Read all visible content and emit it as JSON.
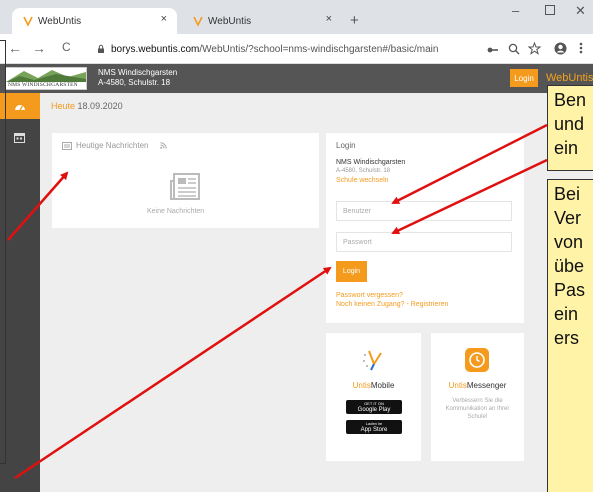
{
  "browser": {
    "tabs": [
      {
        "label": "WebUntis",
        "close": "×"
      },
      {
        "label": "WebUntis",
        "close": "×"
      }
    ],
    "new_tab": "+",
    "window_controls": {
      "minimize": "–",
      "close": "✕"
    },
    "nav": {
      "back": "←",
      "forward": "→",
      "reload": "C"
    },
    "url": {
      "host": "borys.webuntis.com",
      "path": "/WebUntis/?school=nms-windischgarsten#/basic/main"
    },
    "toolbar_icons": [
      "key-icon",
      "zoom-icon",
      "star-icon",
      "profile-icon",
      "menu-icon"
    ]
  },
  "header": {
    "logo_text": "NMS WINDISCHGARSTEN",
    "school_name": "NMS Windischgarsten",
    "school_address": "A-4580, Schulstr. 18",
    "login_button": "Login",
    "brand": "WebUntis"
  },
  "sidebar": {
    "items": [
      {
        "name": "dashboard-icon",
        "glyph": "◕"
      },
      {
        "name": "calendar-icon",
        "glyph": "▦"
      }
    ]
  },
  "main": {
    "today_label": "Heute",
    "today_date": "18.09.2020",
    "news": {
      "title": "Heutige Nachrichten",
      "empty": "Keine Nachrichten"
    },
    "login": {
      "title": "Login",
      "school": "NMS Windischgarsten",
      "address": "A-4580, Schulstr. 18",
      "change_school": "Schule wechseln",
      "username_placeholder": "Benutzer",
      "password_placeholder": "Passwort",
      "button": "Login",
      "forgot": "Passwort vergessen?",
      "register": "Noch keinen Zugang? - Registrieren"
    },
    "mobile": {
      "name_prefix": "Untis",
      "name_suffix": "Mobile",
      "google_small": "GET IT ON",
      "google": "Google Play",
      "apple_small": "Laden im",
      "apple": "App Store"
    },
    "messenger": {
      "name_prefix": "Untis",
      "name_suffix": "Messenger",
      "description": "Verbessern Sie die Kommunikation an Ihrer Schule!"
    }
  },
  "callouts": {
    "top_lines": [
      "Ben",
      "und",
      "ein"
    ],
    "bottom_lines": [
      "Bei",
      "Ver",
      "von",
      "übe",
      "Pas",
      "ein",
      "ers"
    ]
  },
  "colors": {
    "accent": "#f49b1e",
    "header_bg": "#555555",
    "sidebar_bg": "#444444",
    "callout_bg": "#fff3a8",
    "arrow": "#e01010"
  }
}
